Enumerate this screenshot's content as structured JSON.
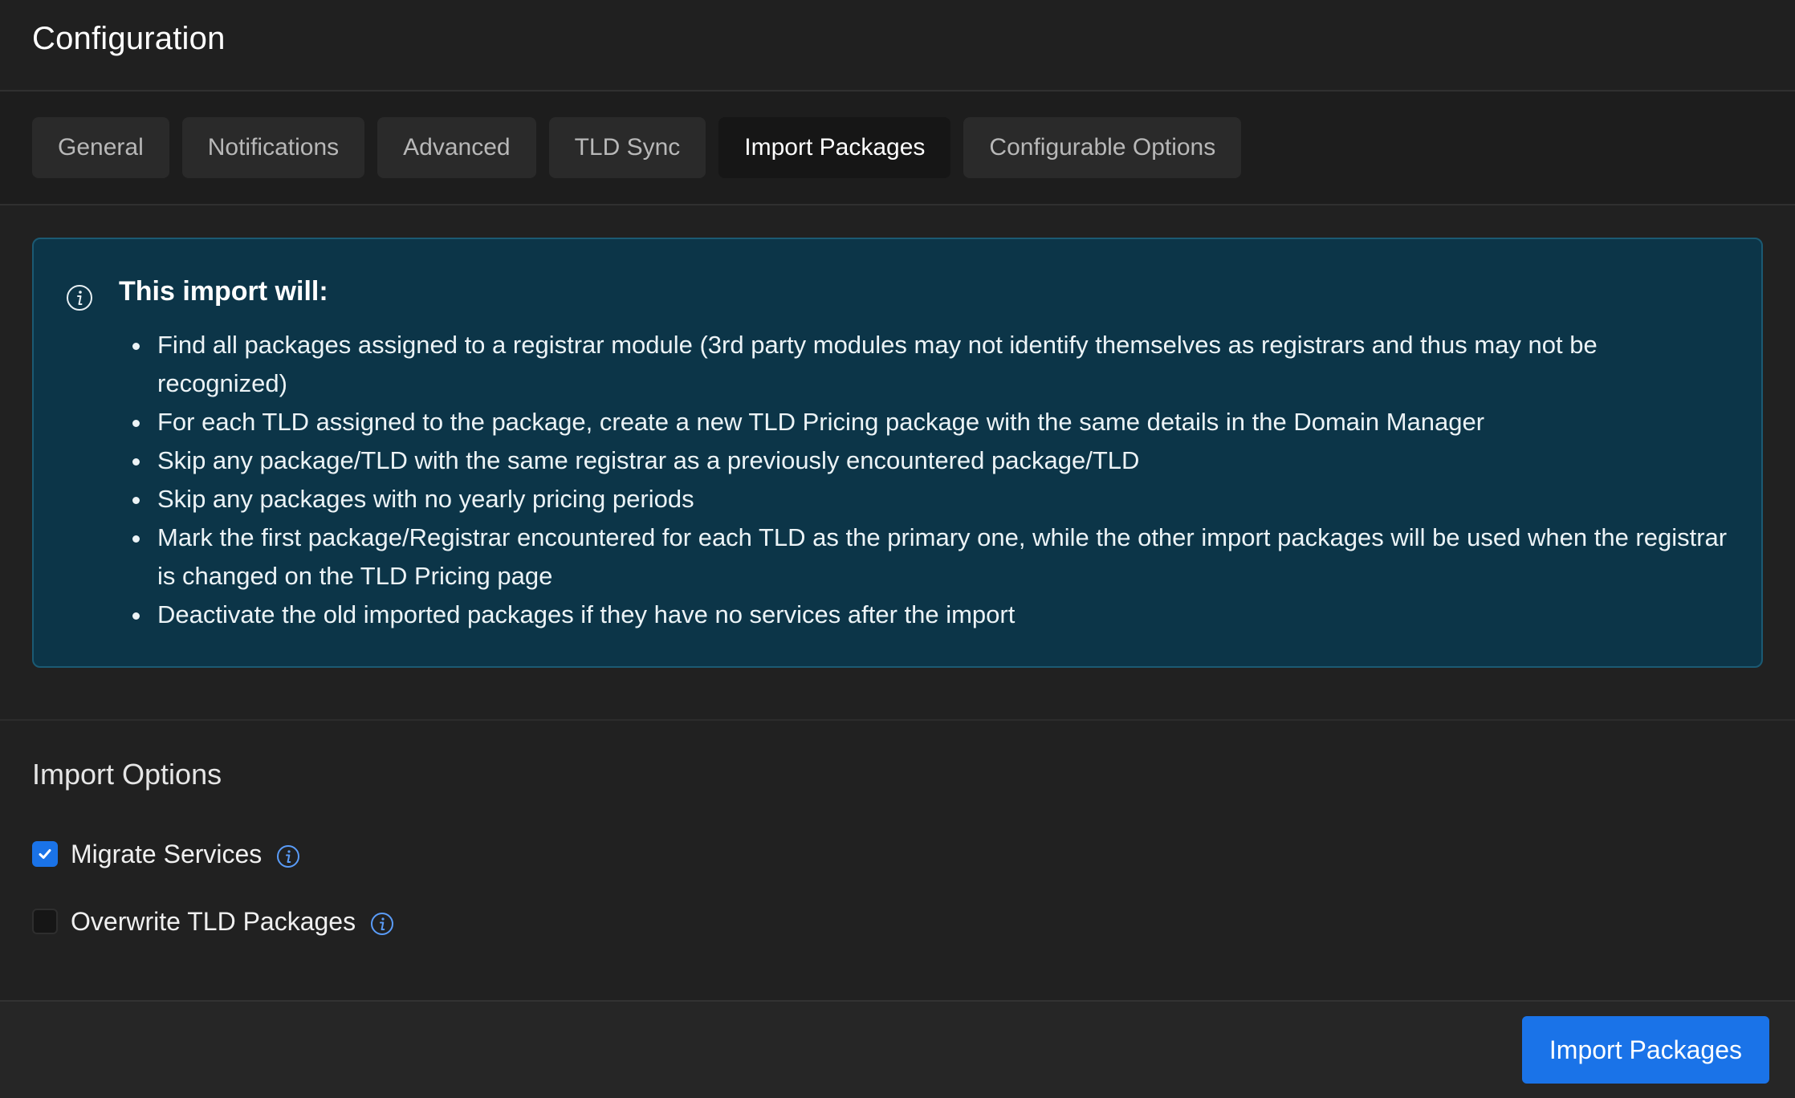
{
  "header": {
    "title": "Configuration"
  },
  "tabs": [
    {
      "label": "General",
      "active": false
    },
    {
      "label": "Notifications",
      "active": false
    },
    {
      "label": "Advanced",
      "active": false
    },
    {
      "label": "TLD Sync",
      "active": false
    },
    {
      "label": "Import Packages",
      "active": true
    },
    {
      "label": "Configurable Options",
      "active": false
    }
  ],
  "info": {
    "icon": "info-icon",
    "title": "This import will:",
    "items": [
      "Find all packages assigned to a registrar module (3rd party modules may not identify themselves as registrars and thus may not be recognized)",
      "For each TLD assigned to the package, create a new TLD Pricing package with the same details in the Domain Manager",
      "Skip any package/TLD with the same registrar as a previously encountered package/TLD",
      "Skip any packages with no yearly pricing periods",
      "Mark the first package/Registrar encountered for each TLD as the primary one, while the other import packages will be used when the registrar is changed on the TLD Pricing page",
      "Deactivate the old imported packages if they have no services after the import"
    ]
  },
  "import_options": {
    "title": "Import Options",
    "options": [
      {
        "label": "Migrate Services",
        "checked": true,
        "icon": "info-icon"
      },
      {
        "label": "Overwrite TLD Packages",
        "checked": false,
        "icon": "info-icon"
      }
    ]
  },
  "footer": {
    "button_label": "Import Packages"
  },
  "colors": {
    "accent": "#1a73e8",
    "info_background": "#0c3548",
    "info_border": "#1b5a73",
    "background": "#212121"
  }
}
